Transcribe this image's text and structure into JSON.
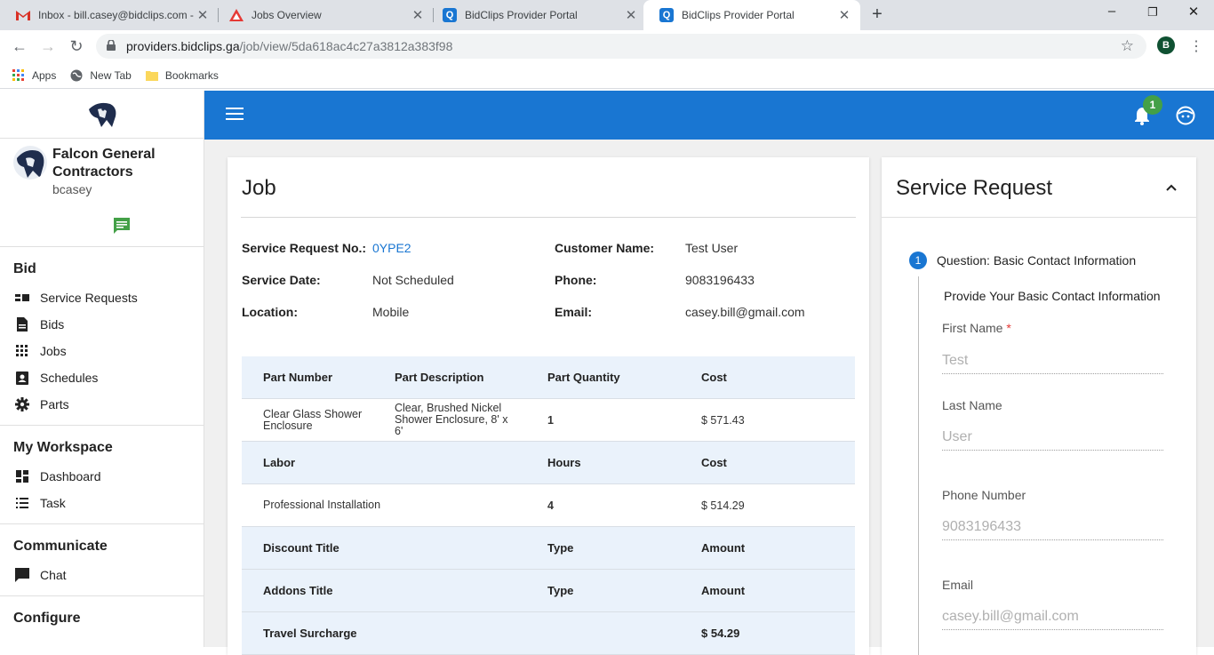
{
  "browser": {
    "tabs": [
      {
        "title": "Inbox - bill.casey@bidclips.com -",
        "icon": "gmail-icon"
      },
      {
        "title": "Jobs Overview",
        "icon": "app-icon"
      },
      {
        "title": "BidClips Provider Portal",
        "icon": "bidclips-icon"
      },
      {
        "title": "BidClips Provider Portal",
        "icon": "bidclips-icon",
        "active": true
      }
    ],
    "url_host": "providers.bidclips.ga",
    "url_path": "/job/view/5da618ac4c27a3812a383f98",
    "profile_initial": "B",
    "bookmarks": [
      "Apps",
      "New Tab",
      "Bookmarks"
    ]
  },
  "sidebar": {
    "company": "Falcon General Contractors",
    "username": "bcasey",
    "sections": [
      {
        "title": "Bid",
        "items": [
          "Service Requests",
          "Bids",
          "Jobs",
          "Schedules",
          "Parts"
        ]
      },
      {
        "title": "My Workspace",
        "items": [
          "Dashboard",
          "Task"
        ]
      },
      {
        "title": "Communicate",
        "items": [
          "Chat"
        ]
      },
      {
        "title": "Configure",
        "items": []
      }
    ]
  },
  "topbar": {
    "notifications": "1",
    "accent": "#1976d2",
    "badge_color": "#43a047"
  },
  "job": {
    "title": "Job",
    "fields": {
      "sr_label": "Service Request No.:",
      "sr_value": "0YPE2",
      "customer_label": "Customer Name:",
      "customer_value": "Test User",
      "date_label": "Service Date:",
      "date_value": "Not Scheduled",
      "phone_label": "Phone:",
      "phone_value": "9083196433",
      "location_label": "Location:",
      "location_value": "Mobile",
      "email_label": "Email:",
      "email_value": "casey.bill@gmail.com"
    },
    "table": {
      "parts_head": [
        "Part Number",
        "Part Description",
        "Part Quantity",
        "Cost"
      ],
      "parts_row": [
        "Clear Glass Shower Enclosure",
        "Clear, Brushed Nickel Shower Enclosure, 8' x 6'",
        "1",
        "$ 571.43"
      ],
      "labor_head": [
        "Labor",
        "",
        "Hours",
        "Cost"
      ],
      "labor_row": [
        "Professional Installation",
        "",
        "4",
        "$ 514.29"
      ],
      "discount_head": [
        "Discount Title",
        "",
        "Type",
        "Amount"
      ],
      "addons_head": [
        "Addons Title",
        "",
        "Type",
        "Amount"
      ],
      "travel_row": [
        "Travel Surcharge",
        "",
        "",
        "$ 54.29"
      ]
    }
  },
  "service_request": {
    "title": "Service Request",
    "step_number": "1",
    "step_title": "Question: Basic Contact Information",
    "step_subtitle": "Provide Your Basic Contact Information",
    "fields": [
      {
        "label": "First Name",
        "required": "*",
        "placeholder": "Test"
      },
      {
        "label": "Last Name",
        "placeholder": "User"
      },
      {
        "label": "Phone Number",
        "placeholder": "9083196433"
      },
      {
        "label": "Email",
        "placeholder": "casey.bill@gmail.com"
      }
    ]
  }
}
